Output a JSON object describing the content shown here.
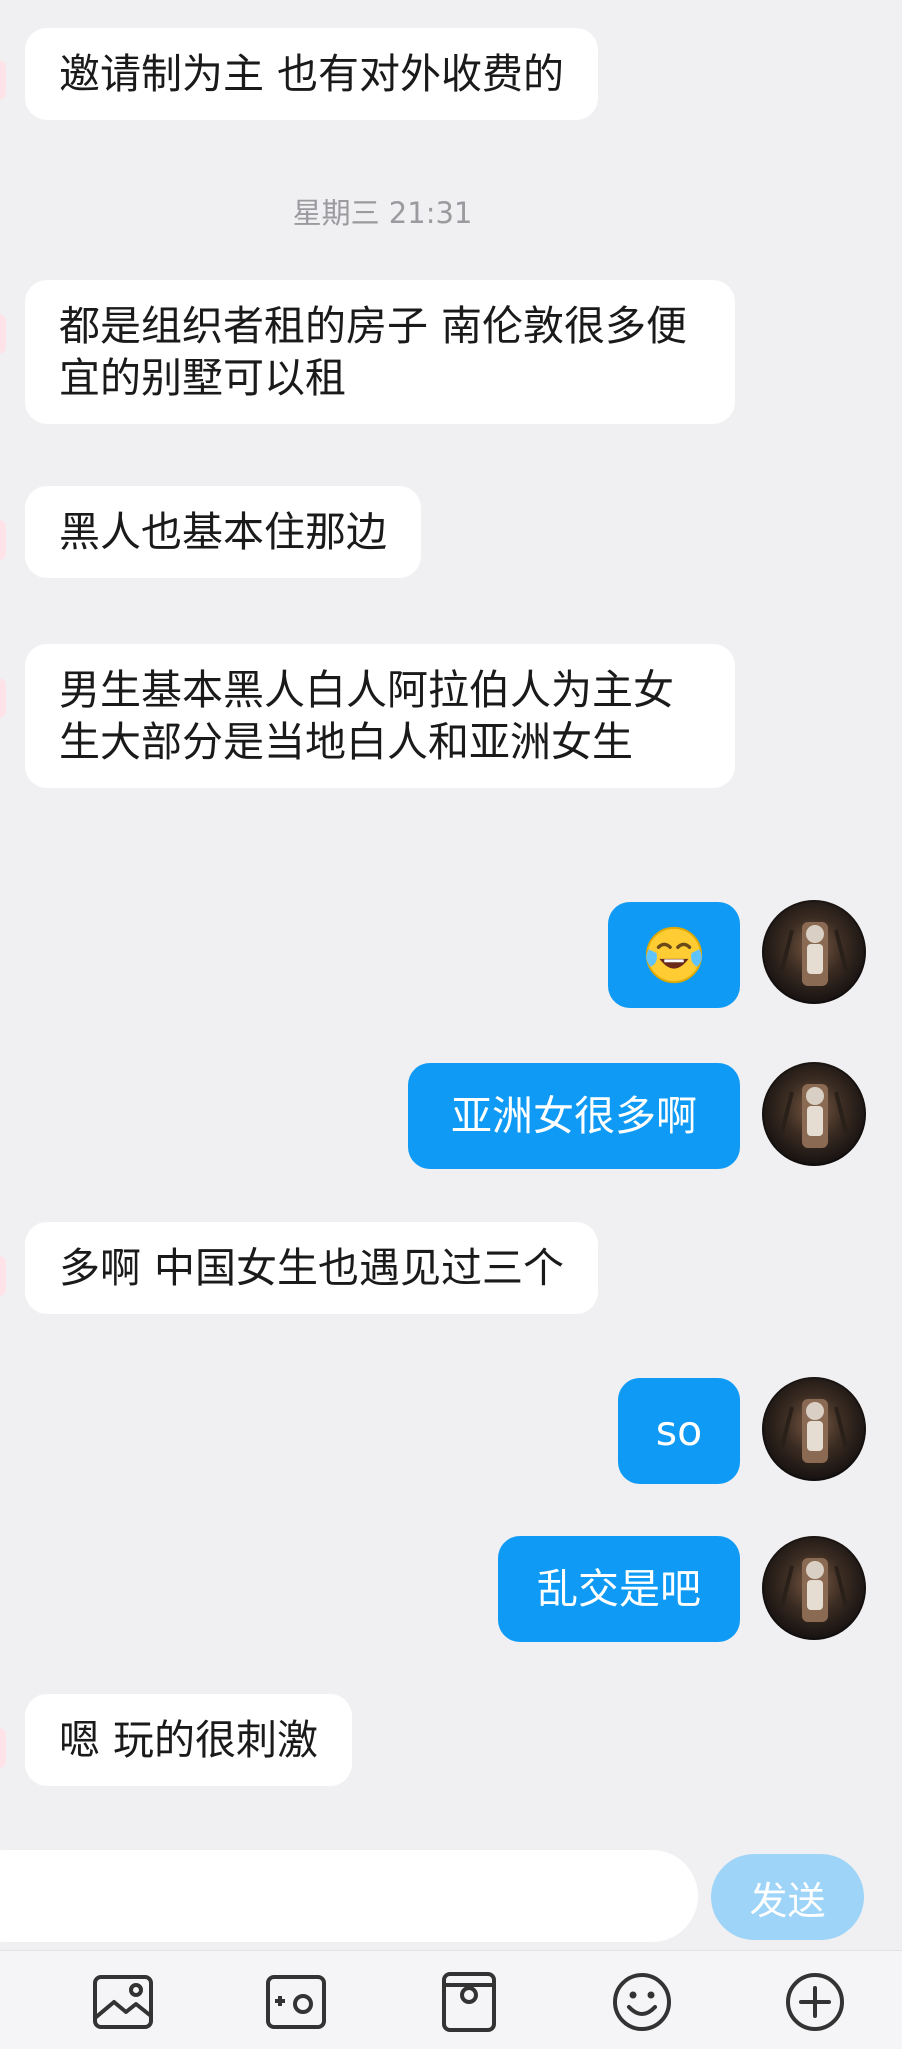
{
  "conversation": {
    "timestamp": "星期三 21:31",
    "messages": [
      {
        "side": "in",
        "text": "邀请制为主 也有对外收费的"
      },
      {
        "side": "in",
        "text": "都是组织者租的房子 南伦敦很多便宜的别墅可以租"
      },
      {
        "side": "in",
        "text": "黑人也基本住那边"
      },
      {
        "side": "in",
        "text": "男生基本黑人白人阿拉伯人为主女生大部分是当地白人和亚洲女生"
      },
      {
        "side": "out",
        "emoji": "face-with-tears-of-joy"
      },
      {
        "side": "out",
        "text": "亚洲女很多啊"
      },
      {
        "side": "in",
        "text": "多啊 中国女生也遇见过三个"
      },
      {
        "side": "out",
        "text": "so"
      },
      {
        "side": "out",
        "text": "乱交是吧"
      },
      {
        "side": "in",
        "text": "嗯 玩的很刺激"
      }
    ]
  },
  "input": {
    "value": "",
    "placeholder": "",
    "send_label": "发送"
  },
  "toolbar": {
    "icons": [
      "image-icon",
      "camera-icon",
      "gift-box-icon",
      "smiley-icon",
      "plus-circle-icon"
    ]
  },
  "colors": {
    "background": "#f0f0f2",
    "incoming_bubble": "#ffffff",
    "outgoing_bubble": "#0f9bf5",
    "send_button": "#9ed4f8",
    "timestamp_text": "#9a9a9f"
  }
}
